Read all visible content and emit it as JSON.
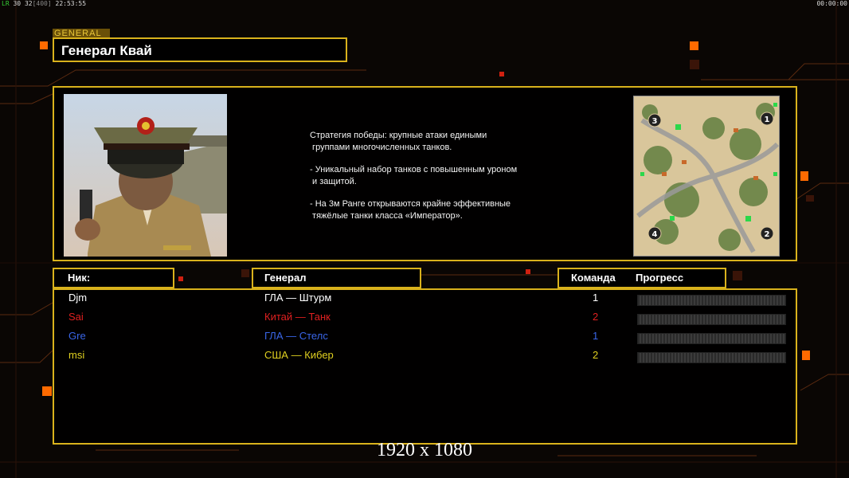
{
  "hud": {
    "fps_label": "LR",
    "fps": "30",
    "fps2": "32",
    "fps_max": "[400]",
    "clock": "22:53:55",
    "timer": "00:00:00"
  },
  "header": {
    "tag": "GENERAL",
    "title": "Генерал Квай"
  },
  "description": {
    "line1": "Стратегия победы: крупные атаки едиными\n группами многочисленных танков.",
    "line2": "- Уникальный набор танков с повышенным уроном\n и защитой.",
    "line3": "- На 3м Ранге открываются крайне эффективные\n тяжёлые танки класса «Император»."
  },
  "minimap": {
    "spawns": [
      "1",
      "2",
      "3",
      "4"
    ]
  },
  "columns": {
    "nick": "Ник:",
    "general": "Генерал",
    "team": "Команда",
    "progress": "Прогресс"
  },
  "players": [
    {
      "nick": "Djm",
      "general": "ГЛА — Штурм",
      "team": "1",
      "color": "#ffffff"
    },
    {
      "nick": "Sai",
      "general": "Китай — Танк",
      "team": "2",
      "color": "#e02020"
    },
    {
      "nick": "Gre",
      "general": "ГЛА — Стелс",
      "team": "1",
      "color": "#3a66e8"
    },
    {
      "nick": "msi",
      "general": "США — Кибер",
      "team": "2",
      "color": "#e0d020"
    }
  ],
  "footer": {
    "resolution": "1920 x 1080"
  },
  "colors": {
    "accent": "#d9b21c",
    "glow": "#ff6a00"
  }
}
